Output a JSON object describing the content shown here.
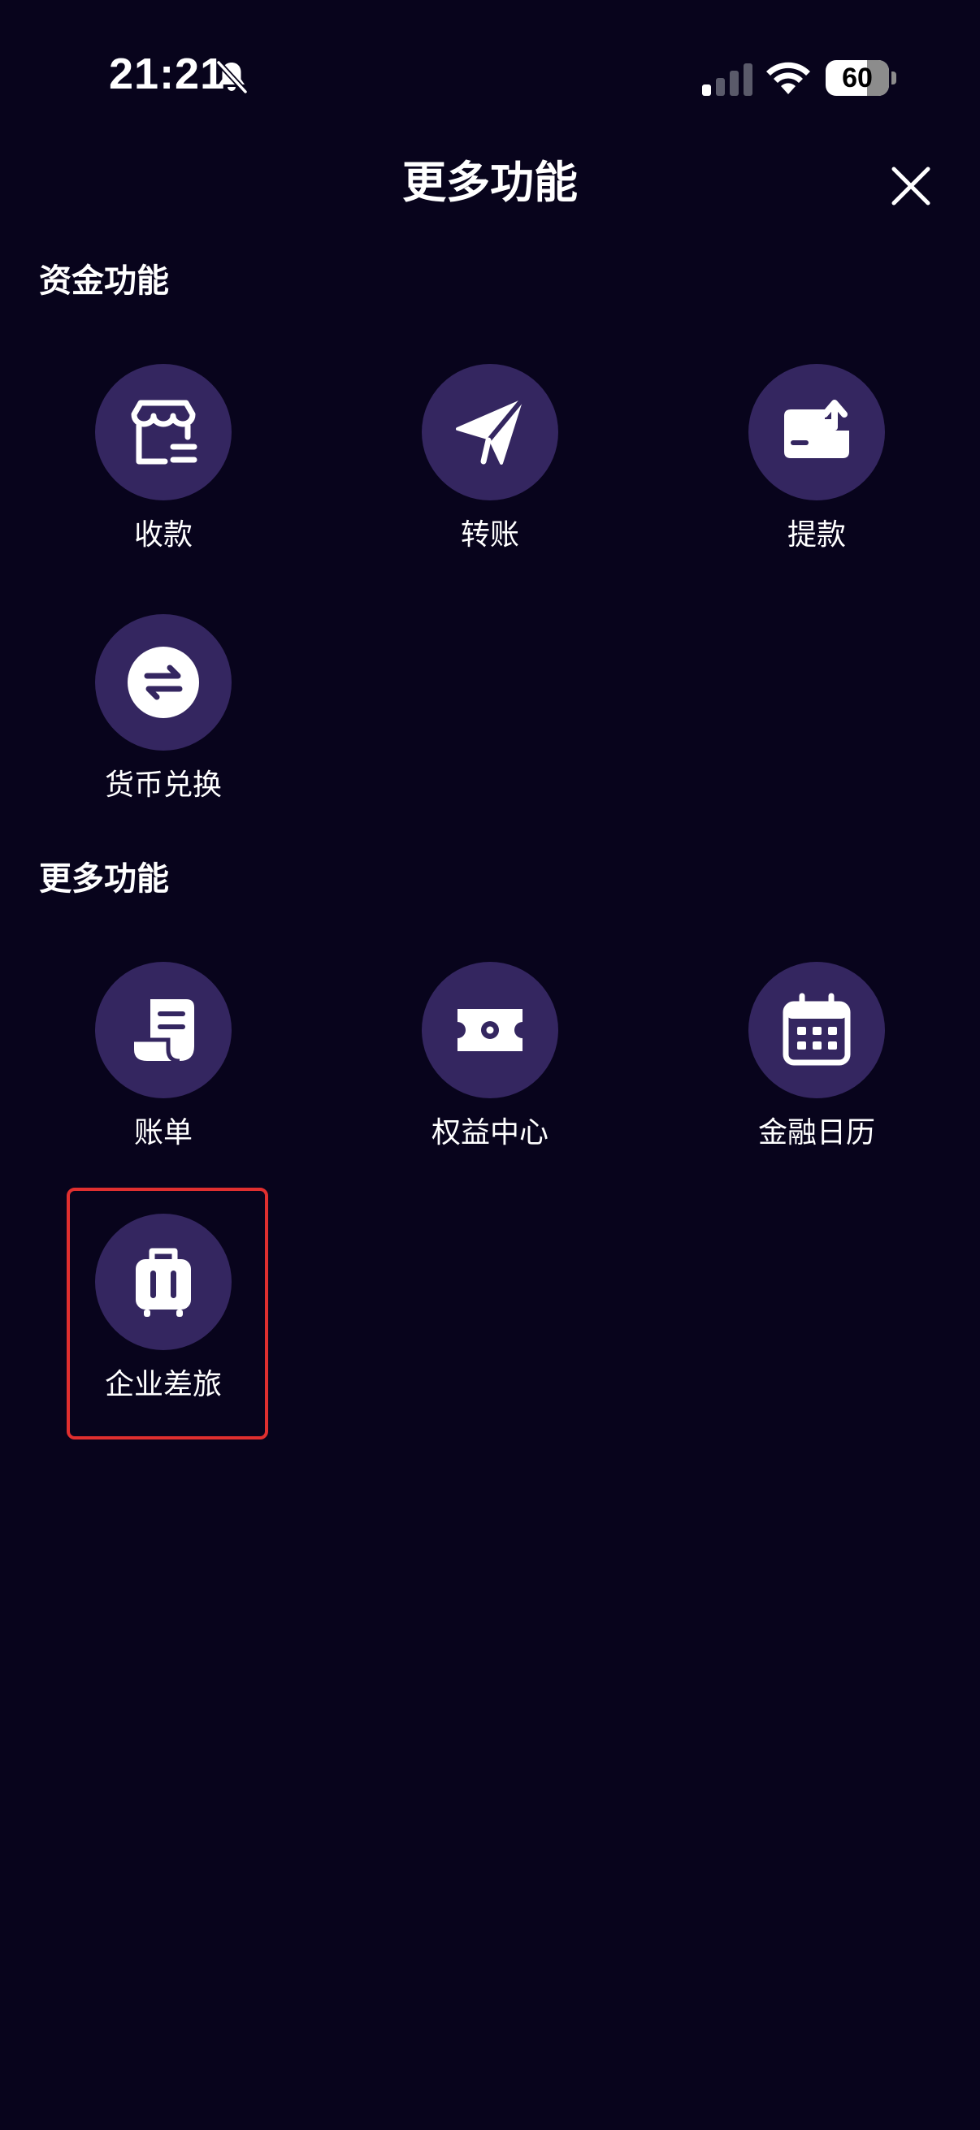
{
  "status_bar": {
    "time": "21:21",
    "battery_level": "60",
    "battery_fraction": 0.6,
    "signal_bars_active": 1,
    "signal_bars_total": 4,
    "icons": [
      "bell-slash-icon",
      "signal-icon",
      "wifi-icon",
      "battery-icon"
    ]
  },
  "header": {
    "title": "更多功能",
    "close_icon": "close-icon"
  },
  "sections": [
    {
      "title": "资金功能",
      "items": [
        {
          "label": "收款",
          "icon": "store-receive-icon"
        },
        {
          "label": "转账",
          "icon": "paper-plane-icon"
        },
        {
          "label": "提款",
          "icon": "withdraw-card-icon"
        },
        {
          "label": "货币兑换",
          "icon": "exchange-arrows-icon"
        }
      ]
    },
    {
      "title": "更多功能",
      "items": [
        {
          "label": "账单",
          "icon": "bill-scroll-icon"
        },
        {
          "label": "权益中心",
          "icon": "ticket-icon"
        },
        {
          "label": "金融日历",
          "icon": "calendar-icon"
        },
        {
          "label": "企业差旅",
          "icon": "suitcase-icon",
          "highlighted": true
        }
      ]
    }
  ],
  "colors": {
    "background": "#08041c",
    "icon_circle": "#342660",
    "text": "#ffffff",
    "highlight_border": "#e02f2f"
  }
}
